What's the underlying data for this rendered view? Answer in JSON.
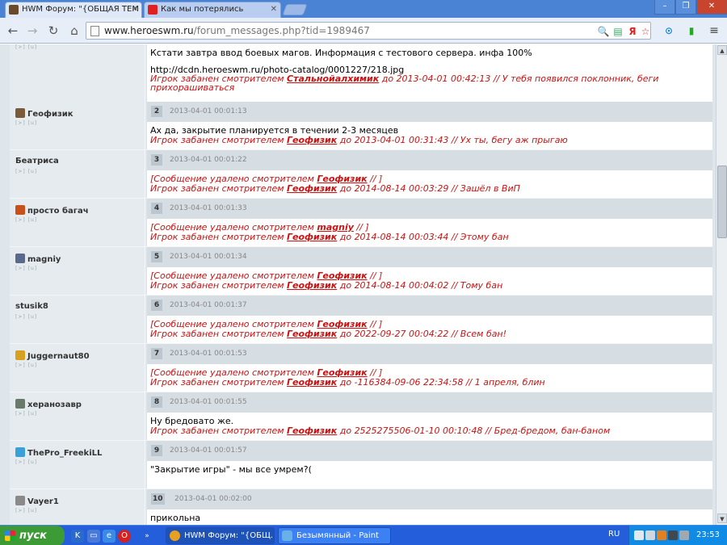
{
  "browser": {
    "tabs": [
      {
        "title": "HWM Форум: \"{ОБЩАЯ ТЕМ"
      },
      {
        "title": "Как мы потерялись"
      }
    ],
    "url_domain": "www.heroeswm.ru",
    "url_path": "/forum_messages.php?tid=1989467"
  },
  "first_post": {
    "links": "[>] [u]",
    "text1": "Кстати завтра ввод боевых магов. Информация с тестового сервера. инфа 100%",
    "text2": "http://dcdn.heroeswm.ru/photo-catalog/0001227/218.jpg",
    "ban_prefix": "Игрок забанен смотрителем ",
    "ban_mod": "Стальнойалхимик",
    "ban_suffix": " до 2013-04-01 00:42:13 // У тебя появился поклонник, беги",
    "ban_line2": "прихорашиваться"
  },
  "posts": [
    {
      "user": "Геофизик",
      "links": "[>] [u]",
      "num": "2",
      "date": "2013-04-01 00:01:13",
      "line1": {
        "type": "text",
        "text": "Ах да, закрытие планируется в течении 2-3 месяцев"
      },
      "line2": {
        "type": "ban",
        "prefix": "Игрок забанен смотрителем ",
        "mod": "Геофизик",
        "suffix": " до 2013-04-01 00:31:43 // Ух ты, бегу аж прыгаю"
      }
    },
    {
      "user": "Беатриса",
      "links": "[>] [u]",
      "num": "3",
      "date": "2013-04-01 00:01:22",
      "line1": {
        "type": "del",
        "prefix": "[Сообщение удалено смотрителем ",
        "mod": "Геофизик",
        "suffix": " // ]"
      },
      "line2": {
        "type": "ban",
        "prefix": "Игрок забанен смотрителем ",
        "mod": "Геофизик",
        "suffix": " до 2014-08-14 00:03:29 // Зашёл в ВиП"
      }
    },
    {
      "user": "просто багач",
      "links": "[>] [u]",
      "num": "4",
      "date": "2013-04-01 00:01:33",
      "line1": {
        "type": "del",
        "prefix": "[Сообщение удалено смотрителем ",
        "mod": "magniy",
        "suffix": " // ]"
      },
      "line2": {
        "type": "ban",
        "prefix": "Игрок забанен смотрителем ",
        "mod": "Геофизик",
        "suffix": " до 2014-08-14 00:03:44 // Этому бан"
      }
    },
    {
      "user": "magniy",
      "links": "[>] [u]",
      "num": "5",
      "date": "2013-04-01 00:01:34",
      "line1": {
        "type": "del",
        "prefix": "[Сообщение удалено смотрителем ",
        "mod": "Геофизик",
        "suffix": " // ]"
      },
      "line2": {
        "type": "ban",
        "prefix": "Игрок забанен смотрителем ",
        "mod": "Геофизик",
        "suffix": " до 2014-08-14 00:04:02 // Тому бан"
      }
    },
    {
      "user": "stusik8",
      "links": "[>] [u]",
      "num": "6",
      "date": "2013-04-01 00:01:37",
      "line1": {
        "type": "del",
        "prefix": "[Сообщение удалено смотрителем ",
        "mod": "Геофизик",
        "suffix": " // ]"
      },
      "line2": {
        "type": "ban",
        "prefix": "Игрок забанен смотрителем ",
        "mod": "Геофизик",
        "suffix": " до 2022-09-27 00:04:22 // Всем бан!"
      }
    },
    {
      "user": "Juggernaut80",
      "links": "[>] [u]",
      "num": "7",
      "date": "2013-04-01 00:01:53",
      "line1": {
        "type": "del",
        "prefix": "[Сообщение удалено смотрителем ",
        "mod": "Геофизик",
        "suffix": " // ]"
      },
      "line2": {
        "type": "ban",
        "prefix": "Игрок забанен смотрителем ",
        "mod": "Геофизик",
        "suffix": " до -116384-09-06 22:34:58 // 1 апреля, блин"
      }
    },
    {
      "user": "херанозавр",
      "links": "[>] [u]",
      "num": "8",
      "date": "2013-04-01 00:01:55",
      "line1": {
        "type": "text",
        "text": "Ну бредовато же."
      },
      "line2": {
        "type": "ban",
        "prefix": "Игрок забанен смотрителем ",
        "mod": "Геофизик",
        "suffix": " до 2525275506-01-10 00:10:48 // Бред-бредом, бан-баном"
      }
    },
    {
      "user": "ThePro_FreekiLL",
      "links": "[>] [u]",
      "num": "9",
      "date": "2013-04-01 00:01:57",
      "line1": {
        "type": "text",
        "text": "\"Закрытие игры\" - мы все умрем?("
      },
      "line2": null
    },
    {
      "user": "Vayer1",
      "links": "[>] [u]",
      "num": "10",
      "date": "2013-04-01 00:02:00",
      "line1": {
        "type": "text",
        "text": "прикольна"
      },
      "line2": null
    }
  ],
  "avatar_colors": [
    "#7a5a3a",
    null,
    "#c8501a",
    "#5b6a8a",
    null,
    "#d8a020",
    "#6a7a6a",
    "#3aa0d8",
    "#8a8a8a"
  ],
  "taskbar": {
    "start_label": "пуск",
    "tasks": [
      {
        "title": "HWM Форум: \"{ОБЩ..."
      },
      {
        "title": "Безымянный - Paint"
      }
    ],
    "language": "RU",
    "clock": "23:53"
  },
  "colors": {
    "tabstrip": "#4b83d4",
    "ban_red": "#d01010",
    "taskbar": "#245edb",
    "start_green": "#3c9b35"
  }
}
